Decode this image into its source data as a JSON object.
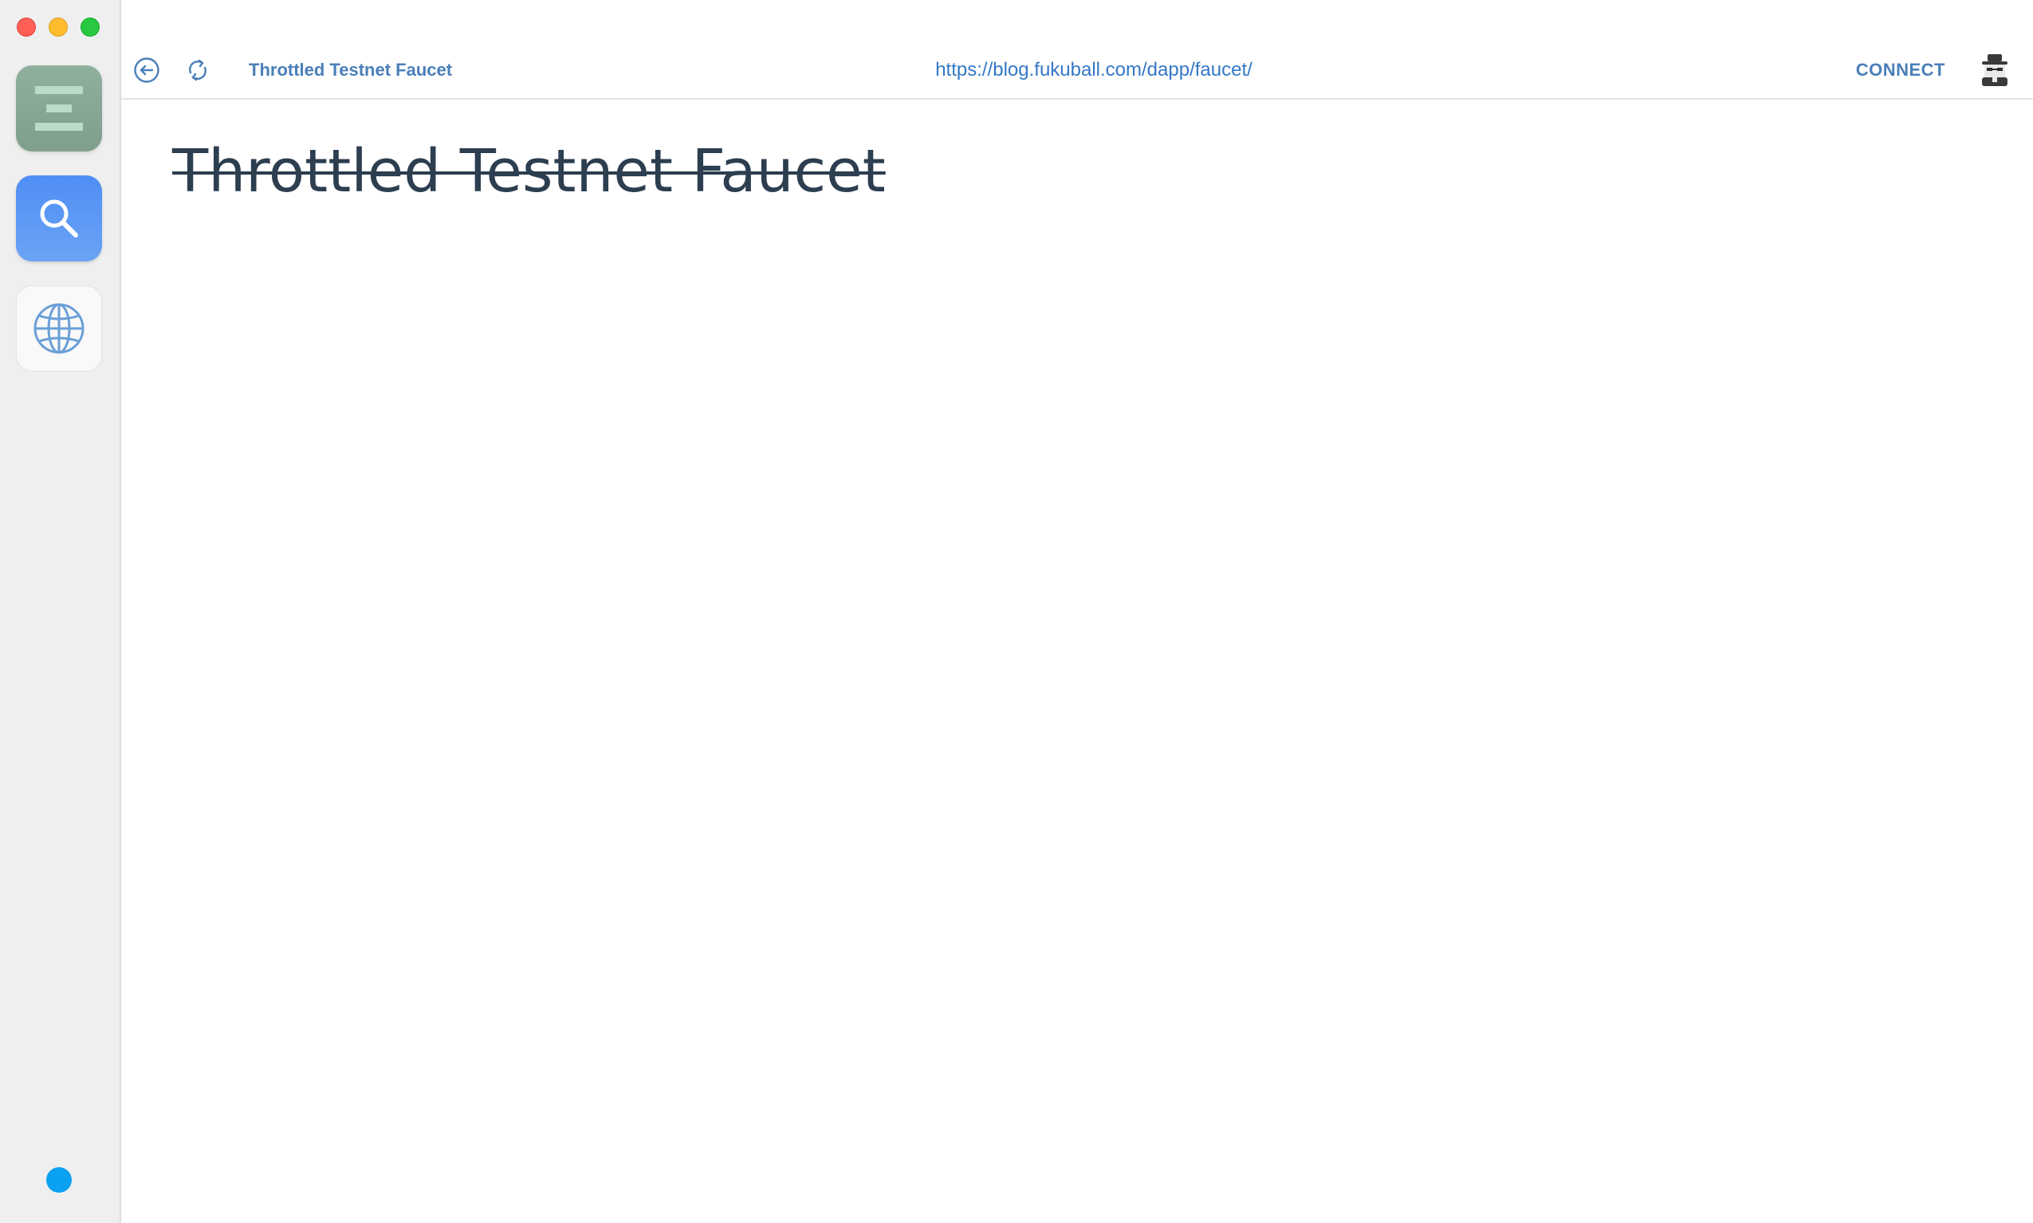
{
  "window": {
    "controls": [
      "close",
      "minimize",
      "maximize"
    ]
  },
  "sidebar": {
    "apps": [
      {
        "name": "ethereum",
        "icon": "ethereum-menu-icon",
        "color": "#8fb09d"
      },
      {
        "name": "search",
        "icon": "search-icon",
        "color": "#4f8ef5"
      },
      {
        "name": "browser",
        "icon": "globe-icon",
        "color": "#f9f9f9"
      }
    ],
    "status_color": "#0ba1f2"
  },
  "toolbar": {
    "tab_title": "Throttled Testnet Faucet",
    "url": "https://blog.fukuball.com/dapp/faucet/",
    "connect_label": "CONNECT",
    "accent_color": "#4a7fb8"
  },
  "page": {
    "heading": "Throttled Testnet Faucet",
    "heading_color": "#2c3e50"
  }
}
